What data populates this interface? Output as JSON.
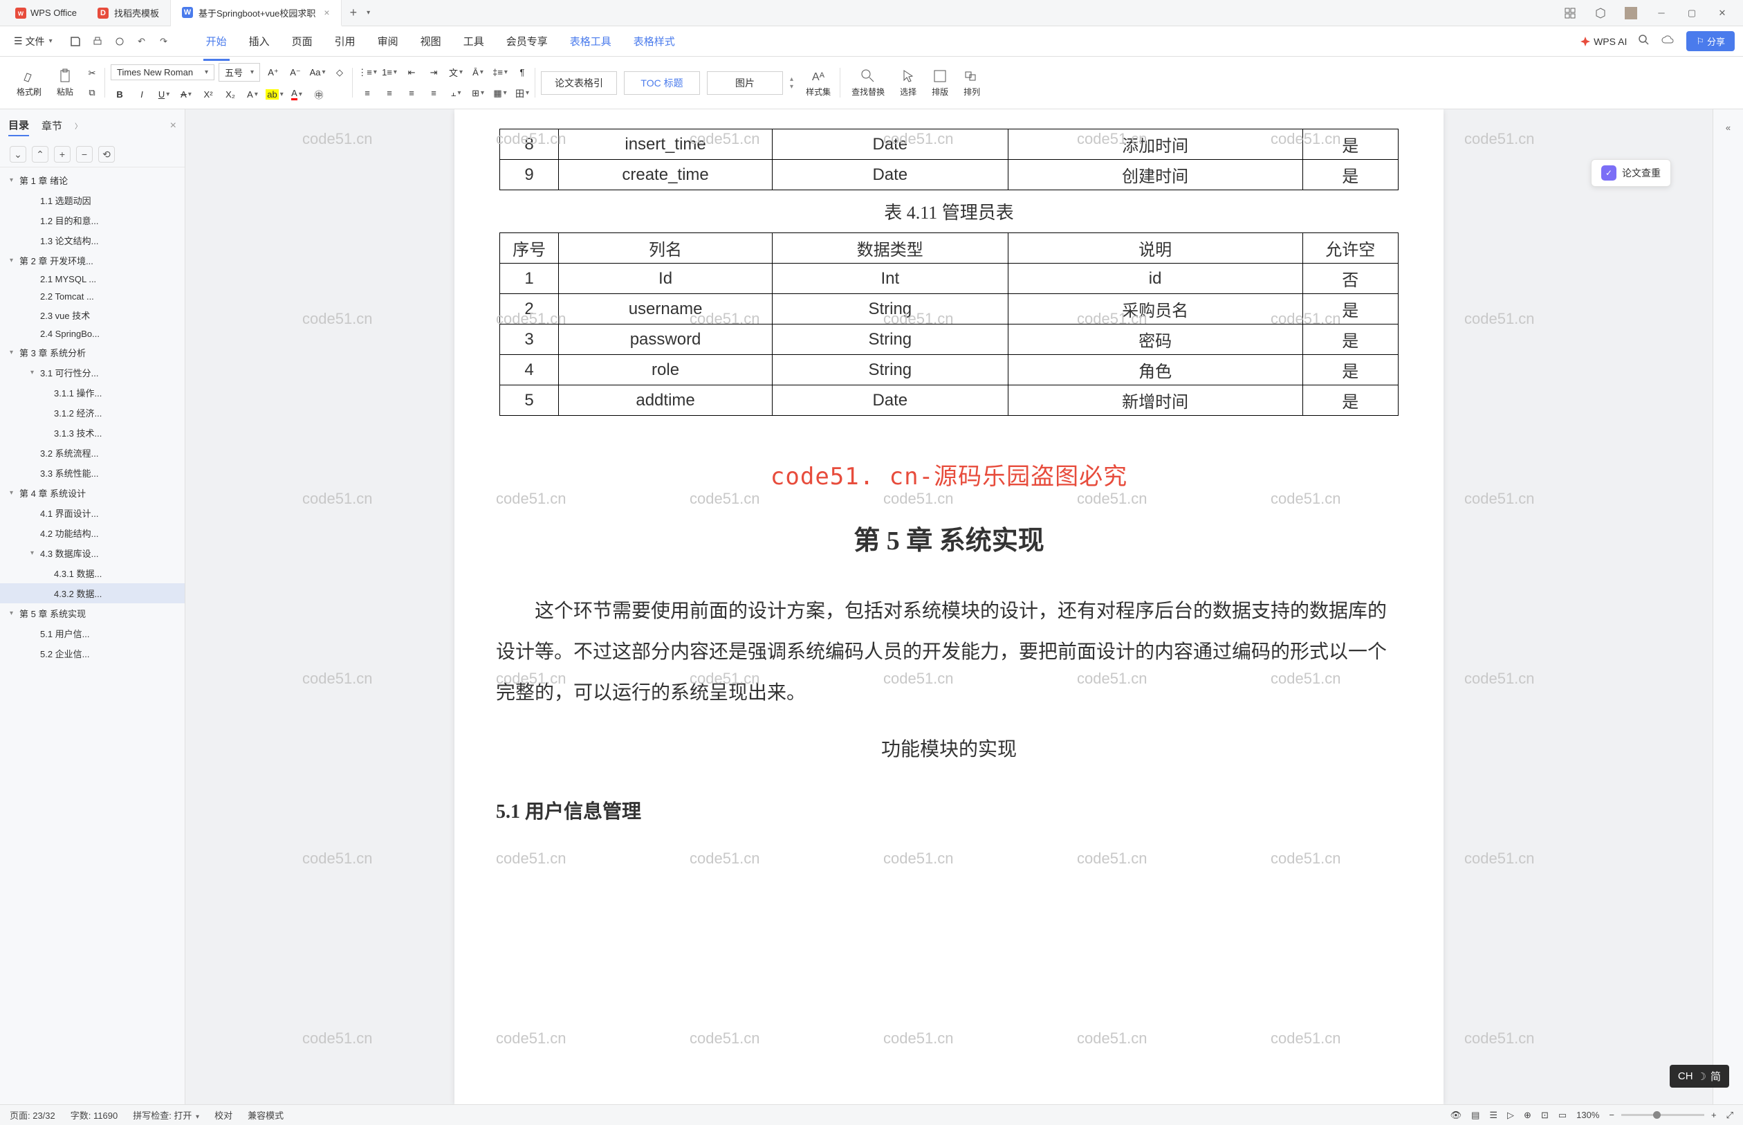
{
  "titlebar": {
    "app_name": "WPS Office",
    "tabs": [
      {
        "label": "找稻壳模板",
        "icon_bg": "#e74c3c",
        "icon_text": "D"
      },
      {
        "label": "基于Springboot+vue校园求职",
        "icon_bg": "#4a7bec",
        "icon_text": "W"
      }
    ]
  },
  "menubar": {
    "file": "文件",
    "items": [
      "开始",
      "插入",
      "页面",
      "引用",
      "审阅",
      "视图",
      "工具",
      "会员专享",
      "表格工具",
      "表格样式"
    ],
    "active_index": 0,
    "wps_ai": "WPS AI",
    "share": "分享"
  },
  "ribbon": {
    "format_painter": "格式刷",
    "paste": "粘贴",
    "font_name": "Times New Roman",
    "font_size": "五号",
    "style_a": "论文表格引",
    "style_b": "TOC 标题",
    "style_c": "图片",
    "styles": "样式集",
    "find": "查找替换",
    "select": "选择",
    "arrange": "排版",
    "align": "排列"
  },
  "sidebar": {
    "tabs": [
      "目录",
      "章节"
    ],
    "toc": [
      {
        "lvl": 1,
        "label": "第 1 章 绪论",
        "caret": true
      },
      {
        "lvl": 2,
        "label": "1.1 选题动因"
      },
      {
        "lvl": 2,
        "label": "1.2 目的和意..."
      },
      {
        "lvl": 2,
        "label": "1.3 论文结构..."
      },
      {
        "lvl": 1,
        "label": "第 2 章 开发环境...",
        "caret": true
      },
      {
        "lvl": 2,
        "label": "2.1 MYSQL ..."
      },
      {
        "lvl": 2,
        "label": "2.2 Tomcat ..."
      },
      {
        "lvl": 2,
        "label": "2.3 vue 技术"
      },
      {
        "lvl": 2,
        "label": "2.4 SpringBo..."
      },
      {
        "lvl": 1,
        "label": "第 3 章 系统分析",
        "caret": true
      },
      {
        "lvl": 2,
        "label": "3.1 可行性分...",
        "caret": true
      },
      {
        "lvl": 3,
        "label": "3.1.1 操作..."
      },
      {
        "lvl": 3,
        "label": "3.1.2 经济..."
      },
      {
        "lvl": 3,
        "label": "3.1.3 技术..."
      },
      {
        "lvl": 2,
        "label": "3.2 系统流程..."
      },
      {
        "lvl": 2,
        "label": "3.3 系统性能..."
      },
      {
        "lvl": 1,
        "label": "第 4 章 系统设计",
        "caret": true
      },
      {
        "lvl": 2,
        "label": "4.1 界面设计..."
      },
      {
        "lvl": 2,
        "label": "4.2 功能结构..."
      },
      {
        "lvl": 2,
        "label": "4.3 数据库设...",
        "caret": true
      },
      {
        "lvl": 3,
        "label": "4.3.1 数据..."
      },
      {
        "lvl": 3,
        "label": "4.3.2 数据...",
        "selected": true
      },
      {
        "lvl": 1,
        "label": "第 5 章 系统实现",
        "caret": true
      },
      {
        "lvl": 2,
        "label": "5.1 用户信..."
      },
      {
        "lvl": 2,
        "label": "5.2 企业信..."
      }
    ]
  },
  "document": {
    "table1_rows": [
      [
        "8",
        "insert_time",
        "Date",
        "添加时间",
        "是"
      ],
      [
        "9",
        "create_time",
        "Date",
        "创建时间",
        "是"
      ]
    ],
    "table2_caption": "表 4.11 管理员表",
    "table2_header": [
      "序号",
      "列名",
      "数据类型",
      "说明",
      "允许空"
    ],
    "table2_rows": [
      [
        "1",
        "Id",
        "Int",
        "id",
        "否"
      ],
      [
        "2",
        "username",
        "String",
        "采购员名",
        "是"
      ],
      [
        "3",
        "password",
        "String",
        "密码",
        "是"
      ],
      [
        "4",
        "role",
        "String",
        "角色",
        "是"
      ],
      [
        "5",
        "addtime",
        "Date",
        "新增时间",
        "是"
      ]
    ],
    "watermark_text": "code51.cn",
    "red_heading": "code51. cn-源码乐园盗图必究",
    "chapter_heading": "第 5 章  系统实现",
    "paragraph": "这个环节需要使用前面的设计方案，包括对系统模块的设计，还有对程序后台的数据支持的数据库的设计等。不过这部分内容还是强调系统编码人员的开发能力，要把前面设计的内容通过编码的形式以一个完整的，可以运行的系统呈现出来。",
    "subheading": "功能模块的实现",
    "section_heading": "5.1 用户信息管理"
  },
  "float_badge": {
    "label": "论文查重"
  },
  "statusbar": {
    "page": "页面: 23/32",
    "words": "字数: 11690",
    "spell": "拼写检查: 打开",
    "proof": "校对",
    "compat": "兼容模式",
    "zoom": "130%"
  },
  "ime": {
    "label": "CH",
    "sub": "简"
  }
}
